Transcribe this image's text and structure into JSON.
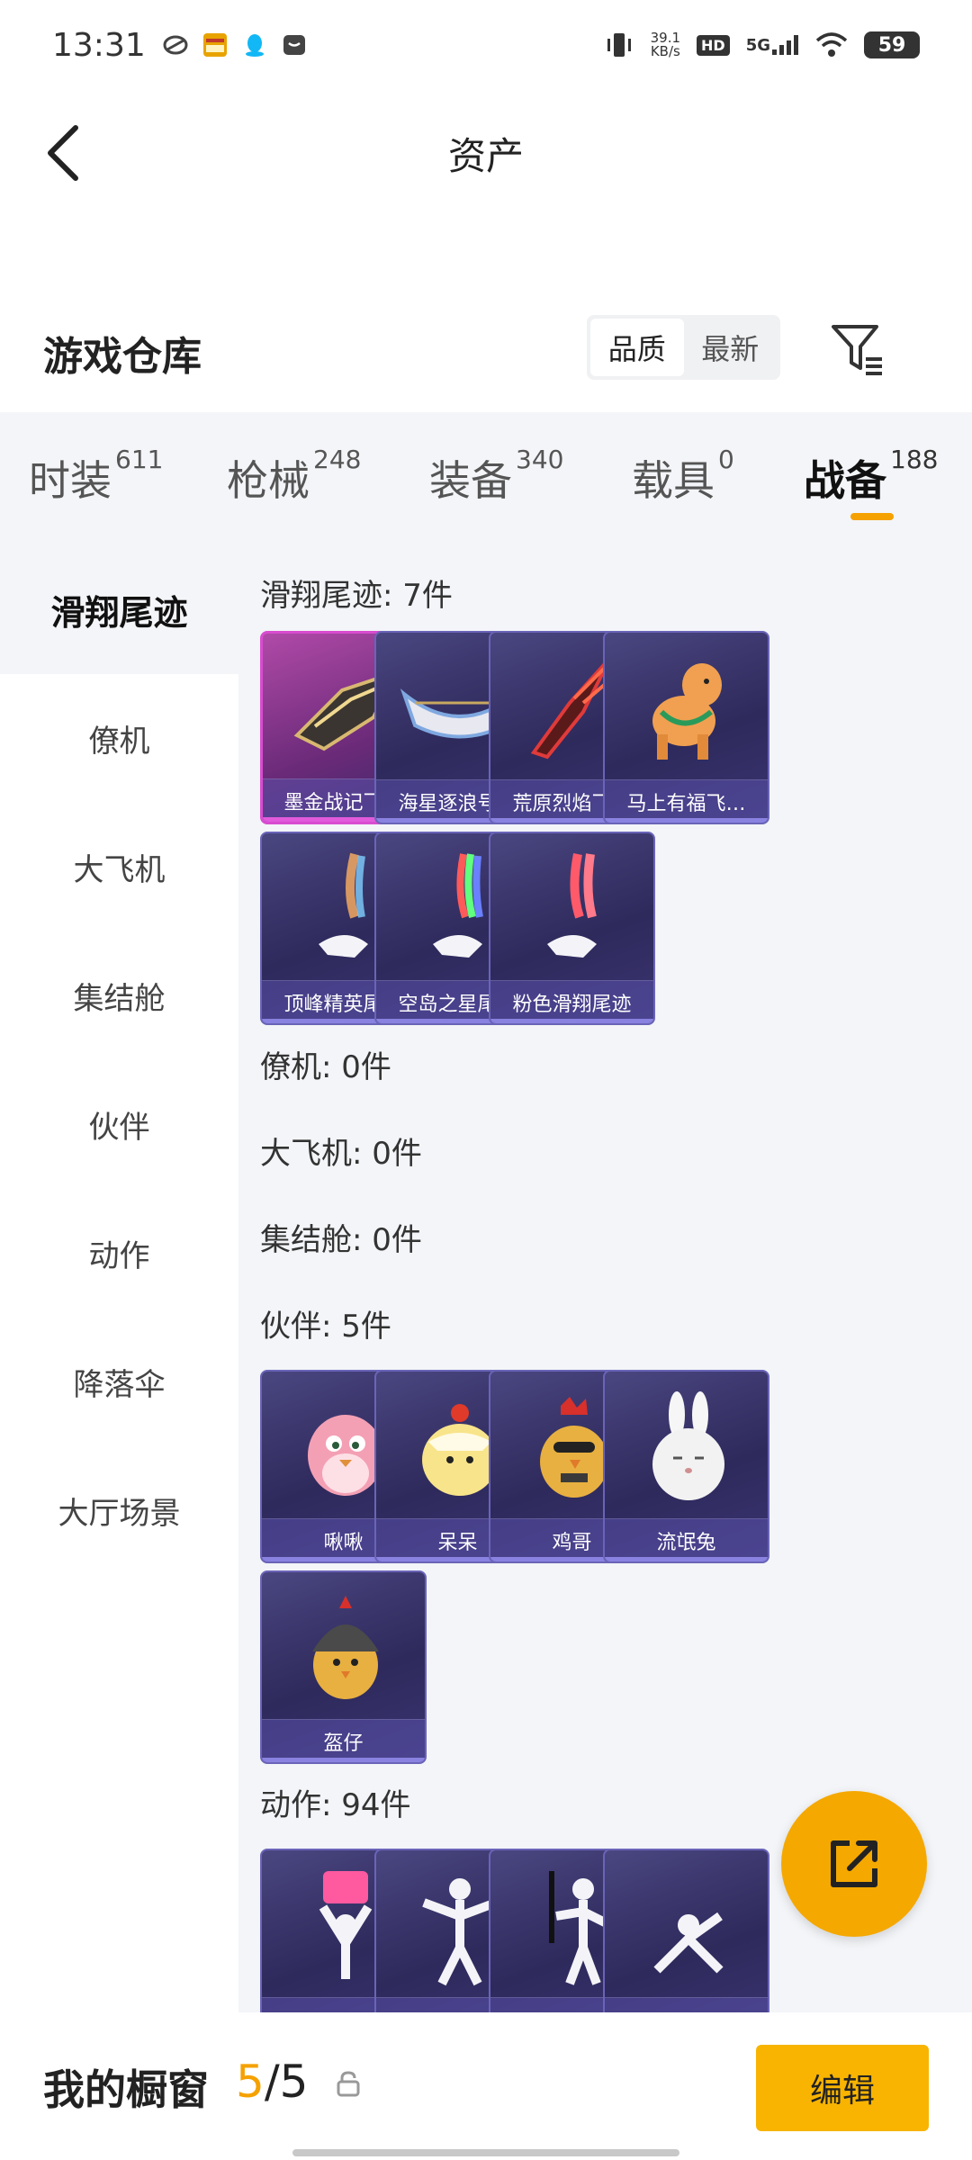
{
  "status_bar": {
    "time": "13:31",
    "net_speed_value": "39.1",
    "net_speed_unit": "KB/s",
    "hd": "HD",
    "network": "5G",
    "battery": "59"
  },
  "header": {
    "title": "资产"
  },
  "warehouse": {
    "title": "游戏仓库",
    "sort_options": [
      "品质",
      "最新"
    ],
    "active_sort": "品质"
  },
  "tabs": [
    {
      "label": "时装",
      "count": "611"
    },
    {
      "label": "枪械",
      "count": "248"
    },
    {
      "label": "装备",
      "count": "340"
    },
    {
      "label": "载具",
      "count": "0"
    },
    {
      "label": "战备",
      "count": "188"
    }
  ],
  "active_tab": "战备",
  "sidebar": {
    "items": [
      "滑翔尾迹",
      "僚机",
      "大飞机",
      "集结舱",
      "伙伴",
      "动作",
      "降落伞",
      "大厅场景"
    ],
    "active": "滑翔尾迹"
  },
  "sections": [
    {
      "title": "滑翔尾迹: 7件",
      "items": [
        "墨金战记飞…",
        "海星逐浪号…",
        "荒原烈焰飞…",
        "马上有福飞…",
        "顶峰精英尾迹",
        "空岛之星尾迹",
        "粉色滑翔尾迹"
      ]
    },
    {
      "title": "僚机: 0件",
      "items": []
    },
    {
      "title": "大飞机: 0件",
      "items": []
    },
    {
      "title": "集结舱: 0件",
      "items": []
    },
    {
      "title": "伙伴: 5件",
      "items": [
        "啾啾",
        "呆呆",
        "鸡哥",
        "流氓兔",
        "盔仔"
      ]
    },
    {
      "title": "动作: 94件",
      "items": [
        "",
        "",
        "",
        ""
      ]
    }
  ],
  "bottom": {
    "showcase_label": "我的橱窗",
    "showcase_current": "5",
    "showcase_sep": "/",
    "showcase_total": "5",
    "edit_label": "编辑"
  },
  "colors": {
    "accent": "#f5a100",
    "card_bg": "#2e2a5c",
    "rare_border": "#d84cd0"
  }
}
